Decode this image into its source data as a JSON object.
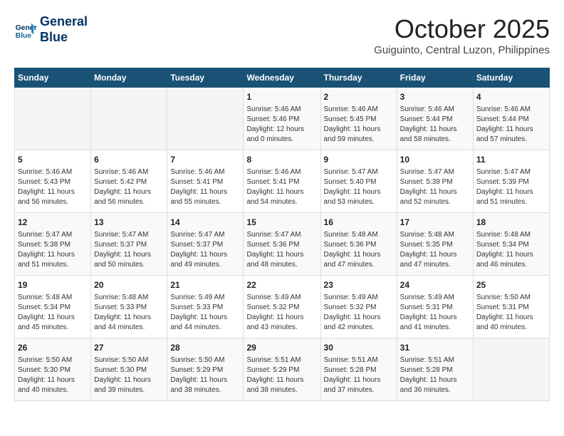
{
  "header": {
    "logo_line1": "General",
    "logo_line2": "Blue",
    "month": "October 2025",
    "location": "Guiguinto, Central Luzon, Philippines"
  },
  "weekdays": [
    "Sunday",
    "Monday",
    "Tuesday",
    "Wednesday",
    "Thursday",
    "Friday",
    "Saturday"
  ],
  "weeks": [
    [
      {
        "day": "",
        "info": ""
      },
      {
        "day": "",
        "info": ""
      },
      {
        "day": "",
        "info": ""
      },
      {
        "day": "1",
        "info": "Sunrise: 5:46 AM\nSunset: 5:46 PM\nDaylight: 12 hours\nand 0 minutes."
      },
      {
        "day": "2",
        "info": "Sunrise: 5:46 AM\nSunset: 5:45 PM\nDaylight: 11 hours\nand 59 minutes."
      },
      {
        "day": "3",
        "info": "Sunrise: 5:46 AM\nSunset: 5:44 PM\nDaylight: 11 hours\nand 58 minutes."
      },
      {
        "day": "4",
        "info": "Sunrise: 5:46 AM\nSunset: 5:44 PM\nDaylight: 11 hours\nand 57 minutes."
      }
    ],
    [
      {
        "day": "5",
        "info": "Sunrise: 5:46 AM\nSunset: 5:43 PM\nDaylight: 11 hours\nand 56 minutes."
      },
      {
        "day": "6",
        "info": "Sunrise: 5:46 AM\nSunset: 5:42 PM\nDaylight: 11 hours\nand 56 minutes."
      },
      {
        "day": "7",
        "info": "Sunrise: 5:46 AM\nSunset: 5:41 PM\nDaylight: 11 hours\nand 55 minutes."
      },
      {
        "day": "8",
        "info": "Sunrise: 5:46 AM\nSunset: 5:41 PM\nDaylight: 11 hours\nand 54 minutes."
      },
      {
        "day": "9",
        "info": "Sunrise: 5:47 AM\nSunset: 5:40 PM\nDaylight: 11 hours\nand 53 minutes."
      },
      {
        "day": "10",
        "info": "Sunrise: 5:47 AM\nSunset: 5:39 PM\nDaylight: 11 hours\nand 52 minutes."
      },
      {
        "day": "11",
        "info": "Sunrise: 5:47 AM\nSunset: 5:39 PM\nDaylight: 11 hours\nand 51 minutes."
      }
    ],
    [
      {
        "day": "12",
        "info": "Sunrise: 5:47 AM\nSunset: 5:38 PM\nDaylight: 11 hours\nand 51 minutes."
      },
      {
        "day": "13",
        "info": "Sunrise: 5:47 AM\nSunset: 5:37 PM\nDaylight: 11 hours\nand 50 minutes."
      },
      {
        "day": "14",
        "info": "Sunrise: 5:47 AM\nSunset: 5:37 PM\nDaylight: 11 hours\nand 49 minutes."
      },
      {
        "day": "15",
        "info": "Sunrise: 5:47 AM\nSunset: 5:36 PM\nDaylight: 11 hours\nand 48 minutes."
      },
      {
        "day": "16",
        "info": "Sunrise: 5:48 AM\nSunset: 5:36 PM\nDaylight: 11 hours\nand 47 minutes."
      },
      {
        "day": "17",
        "info": "Sunrise: 5:48 AM\nSunset: 5:35 PM\nDaylight: 11 hours\nand 47 minutes."
      },
      {
        "day": "18",
        "info": "Sunrise: 5:48 AM\nSunset: 5:34 PM\nDaylight: 11 hours\nand 46 minutes."
      }
    ],
    [
      {
        "day": "19",
        "info": "Sunrise: 5:48 AM\nSunset: 5:34 PM\nDaylight: 11 hours\nand 45 minutes."
      },
      {
        "day": "20",
        "info": "Sunrise: 5:48 AM\nSunset: 5:33 PM\nDaylight: 11 hours\nand 44 minutes."
      },
      {
        "day": "21",
        "info": "Sunrise: 5:49 AM\nSunset: 5:33 PM\nDaylight: 11 hours\nand 44 minutes."
      },
      {
        "day": "22",
        "info": "Sunrise: 5:49 AM\nSunset: 5:32 PM\nDaylight: 11 hours\nand 43 minutes."
      },
      {
        "day": "23",
        "info": "Sunrise: 5:49 AM\nSunset: 5:32 PM\nDaylight: 11 hours\nand 42 minutes."
      },
      {
        "day": "24",
        "info": "Sunrise: 5:49 AM\nSunset: 5:31 PM\nDaylight: 11 hours\nand 41 minutes."
      },
      {
        "day": "25",
        "info": "Sunrise: 5:50 AM\nSunset: 5:31 PM\nDaylight: 11 hours\nand 40 minutes."
      }
    ],
    [
      {
        "day": "26",
        "info": "Sunrise: 5:50 AM\nSunset: 5:30 PM\nDaylight: 11 hours\nand 40 minutes."
      },
      {
        "day": "27",
        "info": "Sunrise: 5:50 AM\nSunset: 5:30 PM\nDaylight: 11 hours\nand 39 minutes."
      },
      {
        "day": "28",
        "info": "Sunrise: 5:50 AM\nSunset: 5:29 PM\nDaylight: 11 hours\nand 38 minutes."
      },
      {
        "day": "29",
        "info": "Sunrise: 5:51 AM\nSunset: 5:29 PM\nDaylight: 11 hours\nand 38 minutes."
      },
      {
        "day": "30",
        "info": "Sunrise: 5:51 AM\nSunset: 5:28 PM\nDaylight: 11 hours\nand 37 minutes."
      },
      {
        "day": "31",
        "info": "Sunrise: 5:51 AM\nSunset: 5:28 PM\nDaylight: 11 hours\nand 36 minutes."
      },
      {
        "day": "",
        "info": ""
      }
    ]
  ]
}
